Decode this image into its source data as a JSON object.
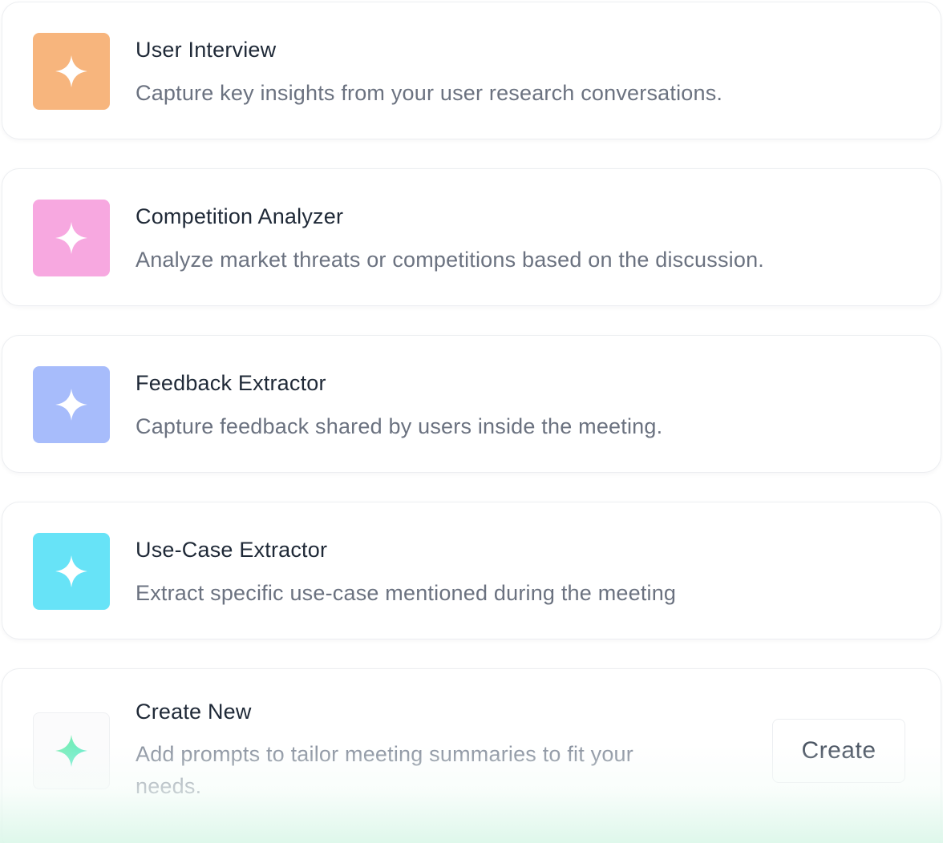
{
  "templates": [
    {
      "title": "User Interview",
      "description": "Capture key insights from your user research conversations.",
      "icon": "sparkle-icon",
      "color": "#f7b57d"
    },
    {
      "title": "Competition Analyzer",
      "description": "Analyze market threats or competitions based on the discussion.",
      "icon": "sparkle-icon",
      "color": "#f7a8e0"
    },
    {
      "title": "Feedback Extractor",
      "description": "Capture feedback shared by users inside the meeting.",
      "icon": "sparkle-icon",
      "color": "#a7bcfb"
    },
    {
      "title": "Use-Case Extractor",
      "description": "Extract specific use-case mentioned during the meeting",
      "icon": "sparkle-icon",
      "color": "#67e3f7"
    }
  ],
  "create_new": {
    "title": "Create New",
    "description": "Add prompts to tailor meeting summaries to fit your needs.",
    "button_label": "Create",
    "icon": "gradient-sparkle-icon",
    "gradient_colors": [
      "#86efac",
      "#5eead4"
    ]
  }
}
